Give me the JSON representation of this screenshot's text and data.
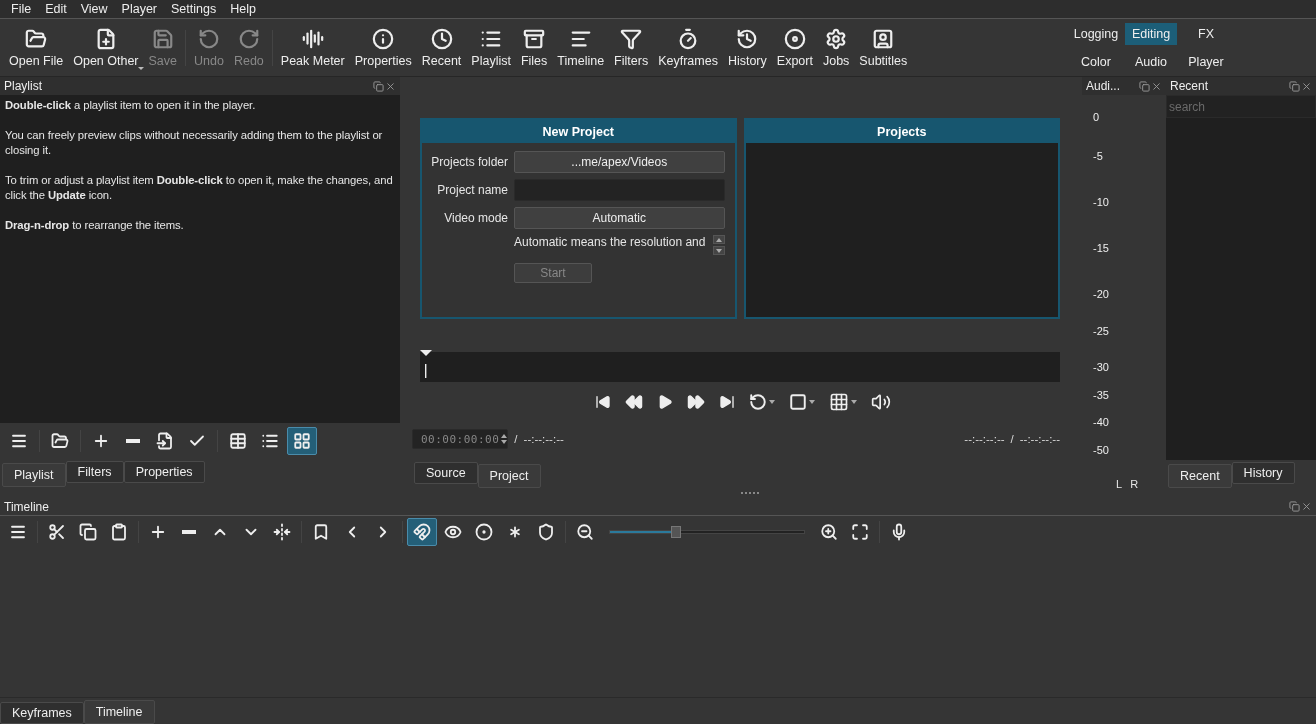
{
  "menu": [
    "File",
    "Edit",
    "View",
    "Player",
    "Settings",
    "Help"
  ],
  "toolbar": [
    {
      "label": "Open File",
      "disabled": false,
      "has_menu": false
    },
    {
      "label": "Open Other",
      "disabled": false,
      "has_menu": true
    },
    {
      "label": "Save",
      "disabled": true,
      "has_menu": false
    },
    {
      "label": "Undo",
      "disabled": true,
      "has_menu": false
    },
    {
      "label": "Redo",
      "disabled": true,
      "has_menu": false
    },
    {
      "label": "Peak Meter",
      "disabled": false,
      "has_menu": false
    },
    {
      "label": "Properties",
      "disabled": false,
      "has_menu": false
    },
    {
      "label": "Recent",
      "disabled": false,
      "has_menu": false
    },
    {
      "label": "Playlist",
      "disabled": false,
      "has_menu": false
    },
    {
      "label": "Files",
      "disabled": false,
      "has_menu": false
    },
    {
      "label": "Timeline",
      "disabled": false,
      "has_menu": false
    },
    {
      "label": "Filters",
      "disabled": false,
      "has_menu": false
    },
    {
      "label": "Keyframes",
      "disabled": false,
      "has_menu": false
    },
    {
      "label": "History",
      "disabled": false,
      "has_menu": false
    },
    {
      "label": "Export",
      "disabled": false,
      "has_menu": false
    },
    {
      "label": "Jobs",
      "disabled": false,
      "has_menu": false
    },
    {
      "label": "Subtitles",
      "disabled": false,
      "has_menu": false
    }
  ],
  "layouts": [
    {
      "label": "Logging",
      "selected": false
    },
    {
      "label": "Editing",
      "selected": true
    },
    {
      "label": "FX",
      "selected": false
    },
    {
      "label": "Color",
      "selected": false
    },
    {
      "label": "Audio",
      "selected": false
    },
    {
      "label": "Player",
      "selected": false
    }
  ],
  "playlist": {
    "title": "Playlist",
    "paragraphs": [
      "**Double-click** a playlist item to open it in the player.",
      "You can freely preview clips without necessarily adding them to the playlist or closing it.",
      "To trim or adjust a playlist item **Double-click** to open it, make the changes, and click the **Update** icon.",
      "**Drag-n-drop** to rearrange the items."
    ],
    "view_modes": [
      {
        "selected": false
      },
      {
        "selected": false
      },
      {
        "selected": true
      }
    ],
    "tabs": [
      {
        "label": "Playlist",
        "selected": true
      },
      {
        "label": "Filters",
        "selected": false
      },
      {
        "label": "Properties",
        "selected": false
      }
    ]
  },
  "new_project": {
    "title": "New Project",
    "fields": [
      {
        "label": "Projects folder",
        "kind": "button",
        "value": "...me/apex/Videos"
      },
      {
        "label": "Project name",
        "kind": "input"
      },
      {
        "label": "Video mode",
        "kind": "button",
        "value": "Automatic"
      }
    ],
    "hint": [
      "Automatic means the resolution and"
    ],
    "start": {
      "label": "Start",
      "disabled": true
    }
  },
  "projects": {
    "title": "Projects"
  },
  "player": {
    "timecode": "00:00:00:00",
    "separator": "/",
    "duration": "--:--:--:--",
    "in_point": "--:--:--:--",
    "in_out_separator": "/",
    "out_point": "--:--:--:--",
    "tabs": [
      {
        "label": "Source",
        "selected": false
      },
      {
        "label": "Project",
        "selected": true
      }
    ]
  },
  "audio_meter": {
    "title": "Audi...",
    "scale": [
      "0",
      "-5",
      "-10",
      "-15",
      "-20",
      "-25",
      "-30",
      "-35",
      "-40",
      "-50"
    ],
    "channels": [
      "L",
      "R"
    ]
  },
  "recent": {
    "title": "Recent",
    "search": {
      "placeholder": "search"
    },
    "tabs": [
      {
        "label": "Recent",
        "selected": true
      },
      {
        "label": "History",
        "selected": false
      }
    ]
  },
  "timeline": {
    "title": "Timeline",
    "toggles": [
      {
        "on": true
      },
      {
        "on": false
      },
      {
        "on": false
      },
      {
        "on": false
      },
      {
        "on": false
      }
    ],
    "zoom": {
      "level": 0.34
    },
    "tabs": [
      {
        "label": "Keyframes",
        "selected": false
      },
      {
        "label": "Timeline",
        "selected": true
      }
    ]
  }
}
